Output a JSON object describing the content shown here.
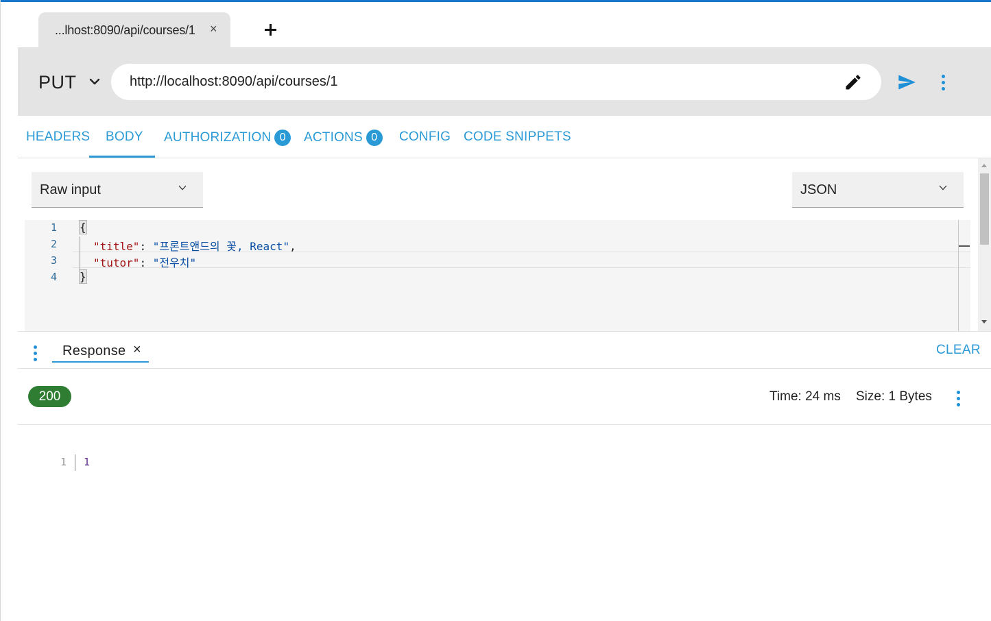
{
  "tab": {
    "title": "...lhost:8090/api/courses/1",
    "close": "×"
  },
  "request": {
    "method": "PUT",
    "url": "http://localhost:8090/api/courses/1"
  },
  "request_tabs": [
    {
      "label": "HEADERS"
    },
    {
      "label": "BODY",
      "active": true
    },
    {
      "label": "AUTHORIZATION",
      "badge": "0"
    },
    {
      "label": "ACTIONS",
      "badge": "0"
    },
    {
      "label": "CONFIG"
    },
    {
      "label": "CODE SNIPPETS"
    }
  ],
  "body": {
    "input_type": "Raw input",
    "content_type": "JSON",
    "editor": {
      "line_numbers": [
        "1",
        "2",
        "3",
        "4"
      ],
      "lines": {
        "l1_brace": "{",
        "l2_key": "\"title\"",
        "l2_colon": ": ",
        "l2_value": "\"프론트앤드의 꽃, React\"",
        "l2_comma": ",",
        "l3_key": "\"tutor\"",
        "l3_colon": ": ",
        "l3_value": "\"전우치\"",
        "l4_brace": "}"
      }
    }
  },
  "response": {
    "tab_label": "Response",
    "tab_close": "×",
    "clear_label": "CLEAR",
    "status_code": "200",
    "time_label": "Time:",
    "time_value": "24 ms",
    "size_label": "Size:",
    "size_value": "1 Bytes",
    "body_line_number": "1",
    "body_text": "1"
  },
  "colors": {
    "accent": "#2a9ad6",
    "status_success": "#2e7d32",
    "toolbar_bg": "#e4e4e4",
    "json_key": "#a31515",
    "json_string": "#0a4fa3"
  },
  "icons": {
    "new_tab": "plus-icon",
    "method_dropdown": "chevron-down-icon",
    "edit": "pencil-icon",
    "send": "send-icon",
    "more": "more-vertical-icon"
  }
}
